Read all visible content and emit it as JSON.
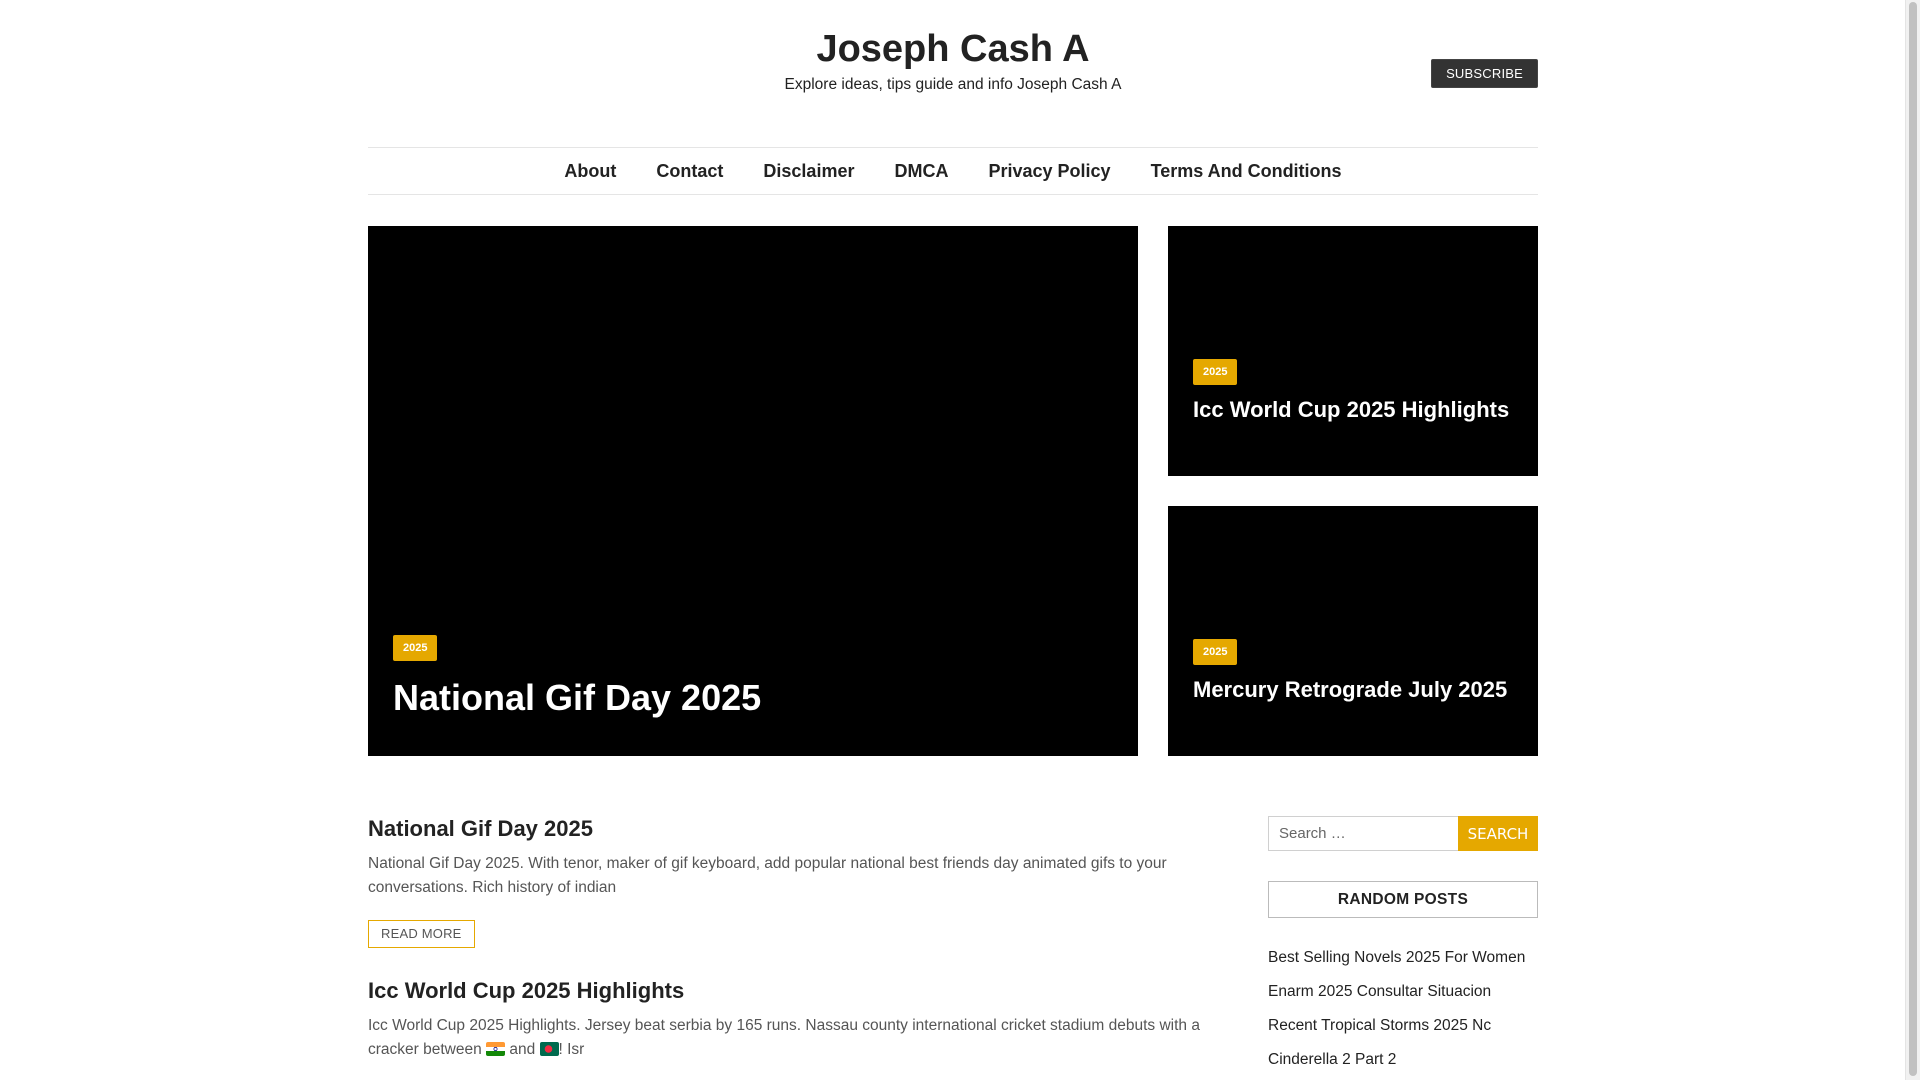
{
  "header": {
    "site_title": "Joseph Cash A",
    "tagline": "Explore ideas, tips guide and info Joseph Cash A",
    "subscribe_label": "SUBSCRIBE"
  },
  "nav": {
    "items": [
      "About",
      "Contact",
      "Disclaimer",
      "DMCA",
      "Privacy Policy",
      "Terms And Conditions"
    ]
  },
  "featured": {
    "main": {
      "category": "2025",
      "title": "National Gif Day 2025"
    },
    "side": [
      {
        "category": "2025",
        "title": "Icc World Cup 2025 Highlights"
      },
      {
        "category": "2025",
        "title": "Mercury Retrograde July 2025"
      }
    ]
  },
  "posts": [
    {
      "title": "National Gif Day 2025",
      "excerpt": "National Gif Day 2025. With tenor, maker of gif keyboard, add popular national best friends day animated gifs to your conversations. Rich history of indian",
      "read_more": "READ MORE"
    },
    {
      "title": "Icc World Cup 2025 Highlights",
      "excerpt_part1": "Icc World Cup 2025 Highlights. Jersey beat serbia by 165 runs. Nassau county international cricket stadium debuts with a cracker between ",
      "flag_1": "india-flag-icon",
      "excerpt_and": " and ",
      "flag_2": "bangladesh-flag-icon",
      "excerpt_part2": "! Isr"
    }
  ],
  "sidebar": {
    "search_placeholder": "Search …",
    "search_button": "SEARCH",
    "random_title": "RANDOM POSTS",
    "random_posts": [
      "Best Selling Novels 2025 For Women",
      "Enarm 2025 Consultar Situacion",
      "Recent Tropical Storms 2025 Nc",
      "Cinderella 2 Part 2"
    ]
  },
  "colors": {
    "accent": "#e5a800",
    "dark": "#333333",
    "featured_bg": "#000000"
  }
}
